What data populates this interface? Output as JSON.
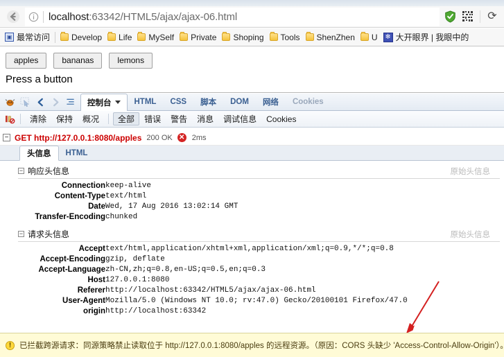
{
  "browser": {
    "back_icon": "back-arrow-icon",
    "url": {
      "info_icon": "info-circle-icon",
      "host": "localhost",
      "path": ":63342/HTML5/ajax/ajax-06.html"
    },
    "right_icons": {
      "shield": "shield-icon",
      "qr": "qr-code-icon",
      "reload": "reload-icon",
      "reload_glyph": "⟳"
    }
  },
  "bookmarks": [
    {
      "icon": "most-visited-icon",
      "label": "最常访问",
      "type": "site"
    },
    {
      "icon": "folder-icon",
      "label": "Develop",
      "type": "folder"
    },
    {
      "icon": "folder-icon",
      "label": "Life",
      "type": "folder"
    },
    {
      "icon": "folder-icon",
      "label": "MySelf",
      "type": "folder"
    },
    {
      "icon": "folder-icon",
      "label": "Private",
      "type": "folder"
    },
    {
      "icon": "folder-icon",
      "label": "Shoping",
      "type": "folder"
    },
    {
      "icon": "folder-icon",
      "label": "Tools",
      "type": "folder"
    },
    {
      "icon": "folder-icon",
      "label": "ShenZhen",
      "type": "folder"
    },
    {
      "icon": "folder-icon",
      "label": "U",
      "type": "folder"
    },
    {
      "icon": "paw-icon",
      "label": "大开眼界 | 我眼中的",
      "type": "paw"
    }
  ],
  "page": {
    "buttons": [
      "apples",
      "bananas",
      "lemons"
    ],
    "status_text": "Press a button"
  },
  "firebug": {
    "toolbar_icons": [
      "firebug-bug-icon",
      "inspector-icon",
      "back-nav-icon",
      "forward-nav-icon",
      "list-icon"
    ],
    "panels": [
      {
        "label": "控制台",
        "active": true,
        "has_caret": true
      },
      {
        "label": "HTML",
        "active": false
      },
      {
        "label": "CSS",
        "active": false
      },
      {
        "label": "脚本",
        "active": false
      },
      {
        "label": "DOM",
        "active": false
      },
      {
        "label": "网络",
        "active": false
      },
      {
        "label": "Cookies",
        "active": false,
        "muted": true
      }
    ],
    "subbar": {
      "icon": "clear-on-reload-icon",
      "actions": [
        "清除",
        "保持",
        "概况"
      ],
      "filters": [
        {
          "label": "全部",
          "selected": true
        },
        {
          "label": "错误",
          "selected": false
        },
        {
          "label": "警告",
          "selected": false
        },
        {
          "label": "消息",
          "selected": false
        },
        {
          "label": "调试信息",
          "selected": false
        },
        {
          "label": "Cookies",
          "selected": false
        }
      ]
    },
    "request": {
      "twisty": "−",
      "method_url": "GET http://127.0.0.1:8080/apples",
      "status": "200 OK",
      "error_badge": "✕",
      "time": "2ms"
    },
    "detail_tabs": [
      {
        "label": "头信息",
        "active": true
      },
      {
        "label": "HTML",
        "active": false
      }
    ],
    "response_headers": {
      "twisty": "−",
      "title": "响应头信息",
      "raw_link": "原始头信息",
      "rows": [
        {
          "name": "Connection",
          "value": "keep-alive"
        },
        {
          "name": "Content-Type",
          "value": "text/html"
        },
        {
          "name": "Date",
          "value": "Wed, 17 Aug 2016 13:02:14 GMT"
        },
        {
          "name": "Transfer-Encoding",
          "value": "chunked"
        }
      ]
    },
    "request_headers": {
      "twisty": "−",
      "title": "请求头信息",
      "raw_link": "原始头信息",
      "rows": [
        {
          "name": "Accept",
          "value": "text/html,application/xhtml+xml,application/xml;q=0.9,*/*;q=0.8"
        },
        {
          "name": "Accept-Encoding",
          "value": "gzip, deflate"
        },
        {
          "name": "Accept-Language",
          "value": "zh-CN,zh;q=0.8,en-US;q=0.5,en;q=0.3"
        },
        {
          "name": "Host",
          "value": "127.0.0.1:8080"
        },
        {
          "name": "Referer",
          "value": "http://localhost:63342/HTML5/ajax/ajax-06.html"
        },
        {
          "name": "User-Agent",
          "value": "Mozilla/5.0 (Windows NT 10.0; rv:47.0) Gecko/20100101 Firefox/47.0"
        },
        {
          "name": "origin",
          "value": "http://localhost:63342"
        }
      ]
    }
  },
  "warning": {
    "icon": "warning-icon",
    "icon_glyph": "!",
    "text": "已拦截跨源请求：同源策略禁止读取位于 http://127.0.0.1:8080/apples 的远程资源。（原因：CORS 头缺少 'Access-Control-Allow-Origin'）。"
  },
  "annotation": {
    "arrow": "red-annotation-arrow",
    "color": "#d42020"
  }
}
